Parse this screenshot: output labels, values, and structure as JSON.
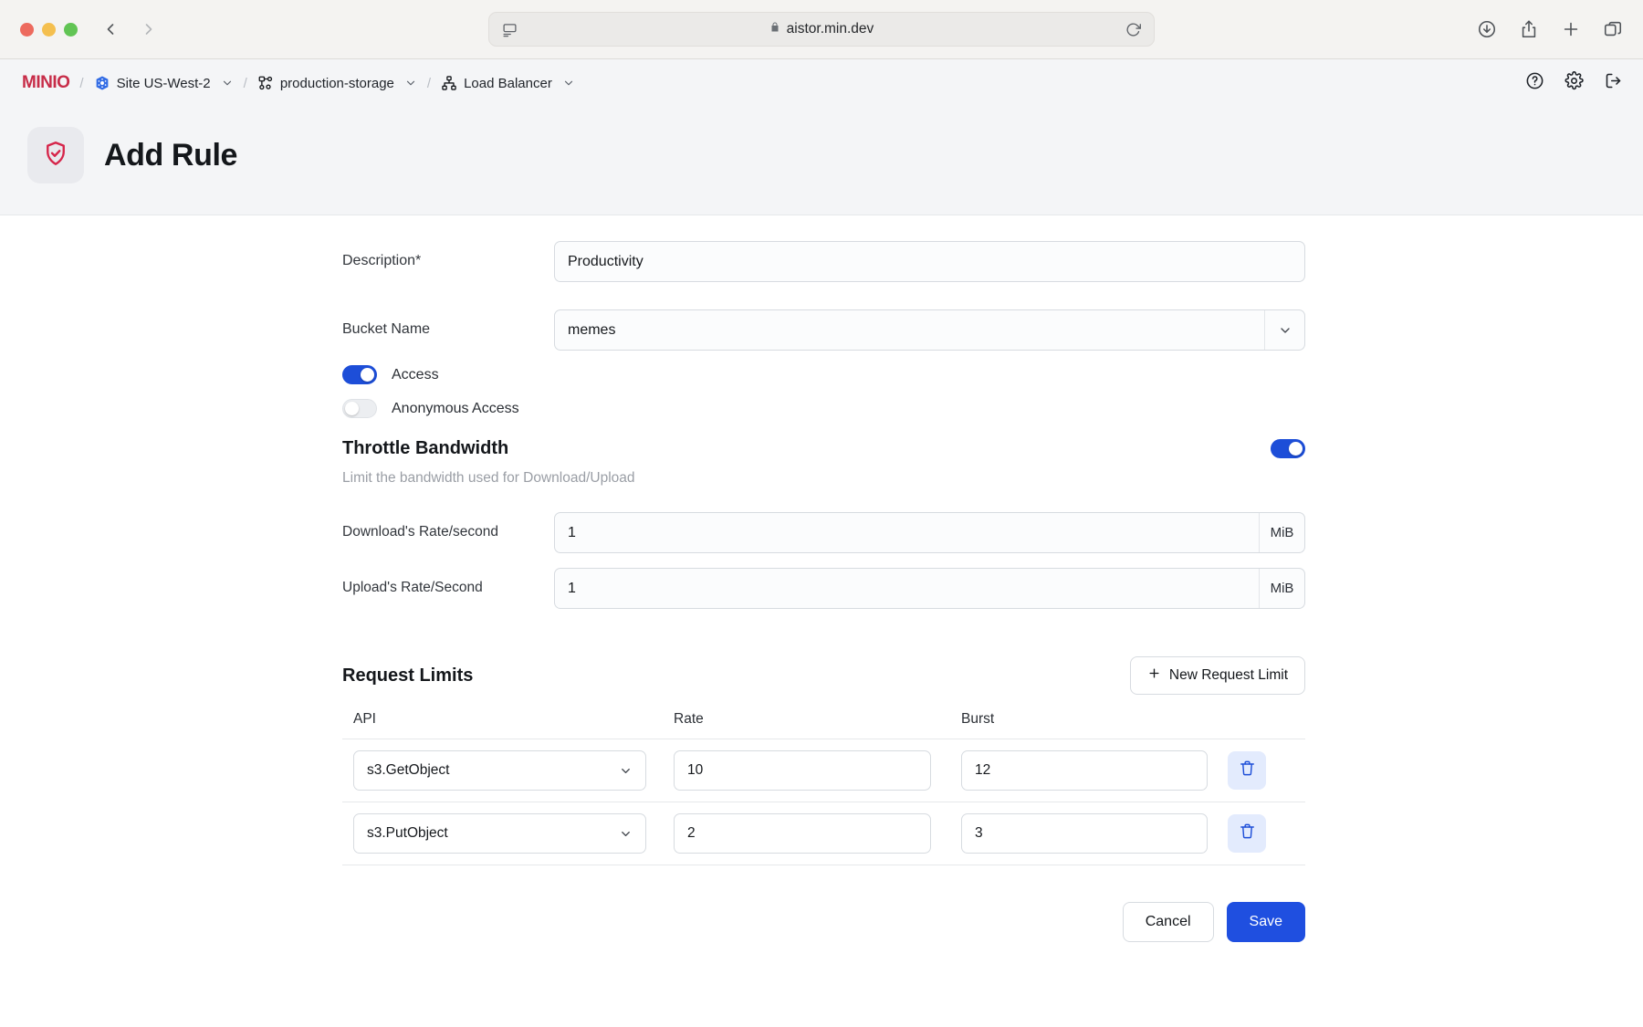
{
  "browser": {
    "url": "aistor.min.dev",
    "lock_icon": "lock-icon",
    "sidebar_icon": "sidebar-toggle-icon",
    "reload_icon": "reload-icon",
    "right_icons": [
      "download-icon",
      "share-icon",
      "new-tab-icon",
      "tab-overview-icon"
    ],
    "back_label": "Back",
    "forward_label": "Forward"
  },
  "app": {
    "brand": {
      "prefix": "MIN",
      "suffix": "IO"
    },
    "breadcrumb": [
      {
        "label": "Site US-West-2",
        "icon": "kubernetes-icon",
        "caret": true
      },
      {
        "label": "production-storage",
        "icon": "cluster-icon",
        "caret": true
      },
      {
        "label": "Load Balancer",
        "icon": "sitemap-icon",
        "caret": true
      }
    ],
    "separator": "/",
    "header_actions": [
      "help-icon",
      "settings-gear-icon",
      "logout-icon"
    ],
    "page_title": "Add Rule",
    "page_icon": "shield-check-icon",
    "accent_color": "#1f4fe0",
    "brand_color": "#c72c48"
  },
  "form": {
    "description": {
      "label": "Description*",
      "value": "Productivity",
      "placeholder": "Description"
    },
    "bucket_name": {
      "label": "Bucket Name",
      "value": "memes",
      "options": [
        "memes"
      ]
    },
    "access_toggle": {
      "label": "Access",
      "on": true
    },
    "anonymous_access_toggle": {
      "label": "Anonymous Access",
      "on": false
    },
    "throttle": {
      "title": "Throttle Bandwidth",
      "subtitle": "Limit the bandwidth used for Download/Upload",
      "on": true,
      "download": {
        "label": "Download's Rate/second",
        "value": "1",
        "unit": "MiB"
      },
      "upload": {
        "label": "Upload's Rate/Second",
        "value": "1",
        "unit": "MiB"
      }
    },
    "request_limits": {
      "title": "Request Limits",
      "new_button": "New Request Limit",
      "new_button_icon": "plus-icon",
      "columns": [
        "API",
        "Rate",
        "Burst"
      ],
      "rows": [
        {
          "api": "s3.GetObject",
          "rate": "10",
          "burst": "12",
          "delete_icon": "trash-icon"
        },
        {
          "api": "s3.PutObject",
          "rate": "2",
          "burst": "3",
          "delete_icon": "trash-icon"
        }
      ]
    },
    "footer": {
      "cancel": "Cancel",
      "save": "Save"
    }
  }
}
